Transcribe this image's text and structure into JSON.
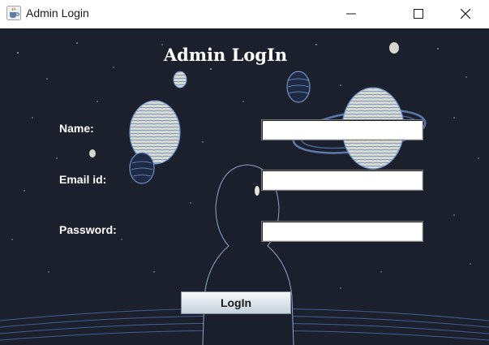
{
  "window": {
    "title": "Admin Login",
    "app_icon": "java-coffee-cup-icon",
    "controls": [
      "minimize-icon",
      "maximize-icon",
      "close-icon"
    ]
  },
  "form": {
    "heading": "Admin LogIn",
    "fields": {
      "name": {
        "label": "Name:",
        "value": ""
      },
      "email": {
        "label": "Email id:",
        "value": ""
      },
      "password": {
        "label": "Password:",
        "value": ""
      }
    },
    "submit_label": "LogIn"
  },
  "colors": {
    "background": "#1c1f2c",
    "text": "#ffffff",
    "planet_outline": "#6f93c8",
    "planet_fill": "#dcdcd4"
  }
}
